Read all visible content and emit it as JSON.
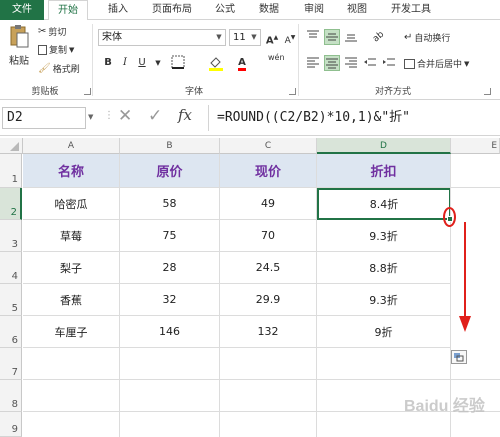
{
  "tabs": [
    "文件",
    "开始",
    "插入",
    "页面布局",
    "公式",
    "数据",
    "审阅",
    "视图",
    "开发工具"
  ],
  "clipboard": {
    "paste": "粘贴",
    "cut": "剪切",
    "copy": "复制",
    "painter": "格式刷",
    "group": "剪贴板"
  },
  "font": {
    "name": "宋体",
    "size": "11",
    "group": "字体",
    "bold": "B",
    "italic": "I",
    "underline": "U",
    "grow": "A",
    "shrink": "A",
    "color_glyph": "A",
    "wen": "wén"
  },
  "alignment": {
    "wrap": "自动换行",
    "merge": "合并后居中",
    "group": "对齐方式"
  },
  "formula_bar": {
    "cell_ref": "D2",
    "formula": "=ROUND((C2/B2)*10,1)&\"折\""
  },
  "columns": [
    "A",
    "B",
    "C",
    "D",
    "E"
  ],
  "rows": [
    "1",
    "2",
    "3",
    "4",
    "5",
    "6",
    "7",
    "8",
    "9"
  ],
  "table": {
    "headers": [
      "名称",
      "原价",
      "现价",
      "折扣"
    ],
    "rows": [
      [
        "哈密瓜",
        "58",
        "49",
        "8.4折"
      ],
      [
        "草莓",
        "75",
        "70",
        "9.3折"
      ],
      [
        "梨子",
        "28",
        "24.5",
        "8.8折"
      ],
      [
        "香蕉",
        "32",
        "29.9",
        "9.3折"
      ],
      [
        "车厘子",
        "146",
        "132",
        "9折"
      ]
    ]
  },
  "watermark": "Baidu 经验",
  "colors": {
    "accent": "#217346",
    "header_fill": "#dde6f1",
    "header_text": "#7030a0",
    "annotation": "#e0201b"
  }
}
